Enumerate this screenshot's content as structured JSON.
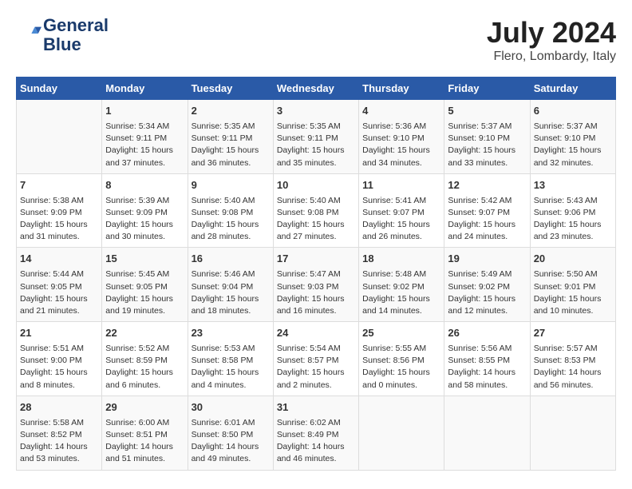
{
  "header": {
    "logo_line1": "General",
    "logo_line2": "Blue",
    "month_year": "July 2024",
    "location": "Flero, Lombardy, Italy"
  },
  "days_of_week": [
    "Sunday",
    "Monday",
    "Tuesday",
    "Wednesday",
    "Thursday",
    "Friday",
    "Saturday"
  ],
  "weeks": [
    [
      {
        "date": "",
        "info": ""
      },
      {
        "date": "1",
        "info": "Sunrise: 5:34 AM\nSunset: 9:11 PM\nDaylight: 15 hours\nand 37 minutes."
      },
      {
        "date": "2",
        "info": "Sunrise: 5:35 AM\nSunset: 9:11 PM\nDaylight: 15 hours\nand 36 minutes."
      },
      {
        "date": "3",
        "info": "Sunrise: 5:35 AM\nSunset: 9:11 PM\nDaylight: 15 hours\nand 35 minutes."
      },
      {
        "date": "4",
        "info": "Sunrise: 5:36 AM\nSunset: 9:10 PM\nDaylight: 15 hours\nand 34 minutes."
      },
      {
        "date": "5",
        "info": "Sunrise: 5:37 AM\nSunset: 9:10 PM\nDaylight: 15 hours\nand 33 minutes."
      },
      {
        "date": "6",
        "info": "Sunrise: 5:37 AM\nSunset: 9:10 PM\nDaylight: 15 hours\nand 32 minutes."
      }
    ],
    [
      {
        "date": "7",
        "info": "Sunrise: 5:38 AM\nSunset: 9:09 PM\nDaylight: 15 hours\nand 31 minutes."
      },
      {
        "date": "8",
        "info": "Sunrise: 5:39 AM\nSunset: 9:09 PM\nDaylight: 15 hours\nand 30 minutes."
      },
      {
        "date": "9",
        "info": "Sunrise: 5:40 AM\nSunset: 9:08 PM\nDaylight: 15 hours\nand 28 minutes."
      },
      {
        "date": "10",
        "info": "Sunrise: 5:40 AM\nSunset: 9:08 PM\nDaylight: 15 hours\nand 27 minutes."
      },
      {
        "date": "11",
        "info": "Sunrise: 5:41 AM\nSunset: 9:07 PM\nDaylight: 15 hours\nand 26 minutes."
      },
      {
        "date": "12",
        "info": "Sunrise: 5:42 AM\nSunset: 9:07 PM\nDaylight: 15 hours\nand 24 minutes."
      },
      {
        "date": "13",
        "info": "Sunrise: 5:43 AM\nSunset: 9:06 PM\nDaylight: 15 hours\nand 23 minutes."
      }
    ],
    [
      {
        "date": "14",
        "info": "Sunrise: 5:44 AM\nSunset: 9:05 PM\nDaylight: 15 hours\nand 21 minutes."
      },
      {
        "date": "15",
        "info": "Sunrise: 5:45 AM\nSunset: 9:05 PM\nDaylight: 15 hours\nand 19 minutes."
      },
      {
        "date": "16",
        "info": "Sunrise: 5:46 AM\nSunset: 9:04 PM\nDaylight: 15 hours\nand 18 minutes."
      },
      {
        "date": "17",
        "info": "Sunrise: 5:47 AM\nSunset: 9:03 PM\nDaylight: 15 hours\nand 16 minutes."
      },
      {
        "date": "18",
        "info": "Sunrise: 5:48 AM\nSunset: 9:02 PM\nDaylight: 15 hours\nand 14 minutes."
      },
      {
        "date": "19",
        "info": "Sunrise: 5:49 AM\nSunset: 9:02 PM\nDaylight: 15 hours\nand 12 minutes."
      },
      {
        "date": "20",
        "info": "Sunrise: 5:50 AM\nSunset: 9:01 PM\nDaylight: 15 hours\nand 10 minutes."
      }
    ],
    [
      {
        "date": "21",
        "info": "Sunrise: 5:51 AM\nSunset: 9:00 PM\nDaylight: 15 hours\nand 8 minutes."
      },
      {
        "date": "22",
        "info": "Sunrise: 5:52 AM\nSunset: 8:59 PM\nDaylight: 15 hours\nand 6 minutes."
      },
      {
        "date": "23",
        "info": "Sunrise: 5:53 AM\nSunset: 8:58 PM\nDaylight: 15 hours\nand 4 minutes."
      },
      {
        "date": "24",
        "info": "Sunrise: 5:54 AM\nSunset: 8:57 PM\nDaylight: 15 hours\nand 2 minutes."
      },
      {
        "date": "25",
        "info": "Sunrise: 5:55 AM\nSunset: 8:56 PM\nDaylight: 15 hours\nand 0 minutes."
      },
      {
        "date": "26",
        "info": "Sunrise: 5:56 AM\nSunset: 8:55 PM\nDaylight: 14 hours\nand 58 minutes."
      },
      {
        "date": "27",
        "info": "Sunrise: 5:57 AM\nSunset: 8:53 PM\nDaylight: 14 hours\nand 56 minutes."
      }
    ],
    [
      {
        "date": "28",
        "info": "Sunrise: 5:58 AM\nSunset: 8:52 PM\nDaylight: 14 hours\nand 53 minutes."
      },
      {
        "date": "29",
        "info": "Sunrise: 6:00 AM\nSunset: 8:51 PM\nDaylight: 14 hours\nand 51 minutes."
      },
      {
        "date": "30",
        "info": "Sunrise: 6:01 AM\nSunset: 8:50 PM\nDaylight: 14 hours\nand 49 minutes."
      },
      {
        "date": "31",
        "info": "Sunrise: 6:02 AM\nSunset: 8:49 PM\nDaylight: 14 hours\nand 46 minutes."
      },
      {
        "date": "",
        "info": ""
      },
      {
        "date": "",
        "info": ""
      },
      {
        "date": "",
        "info": ""
      }
    ]
  ]
}
